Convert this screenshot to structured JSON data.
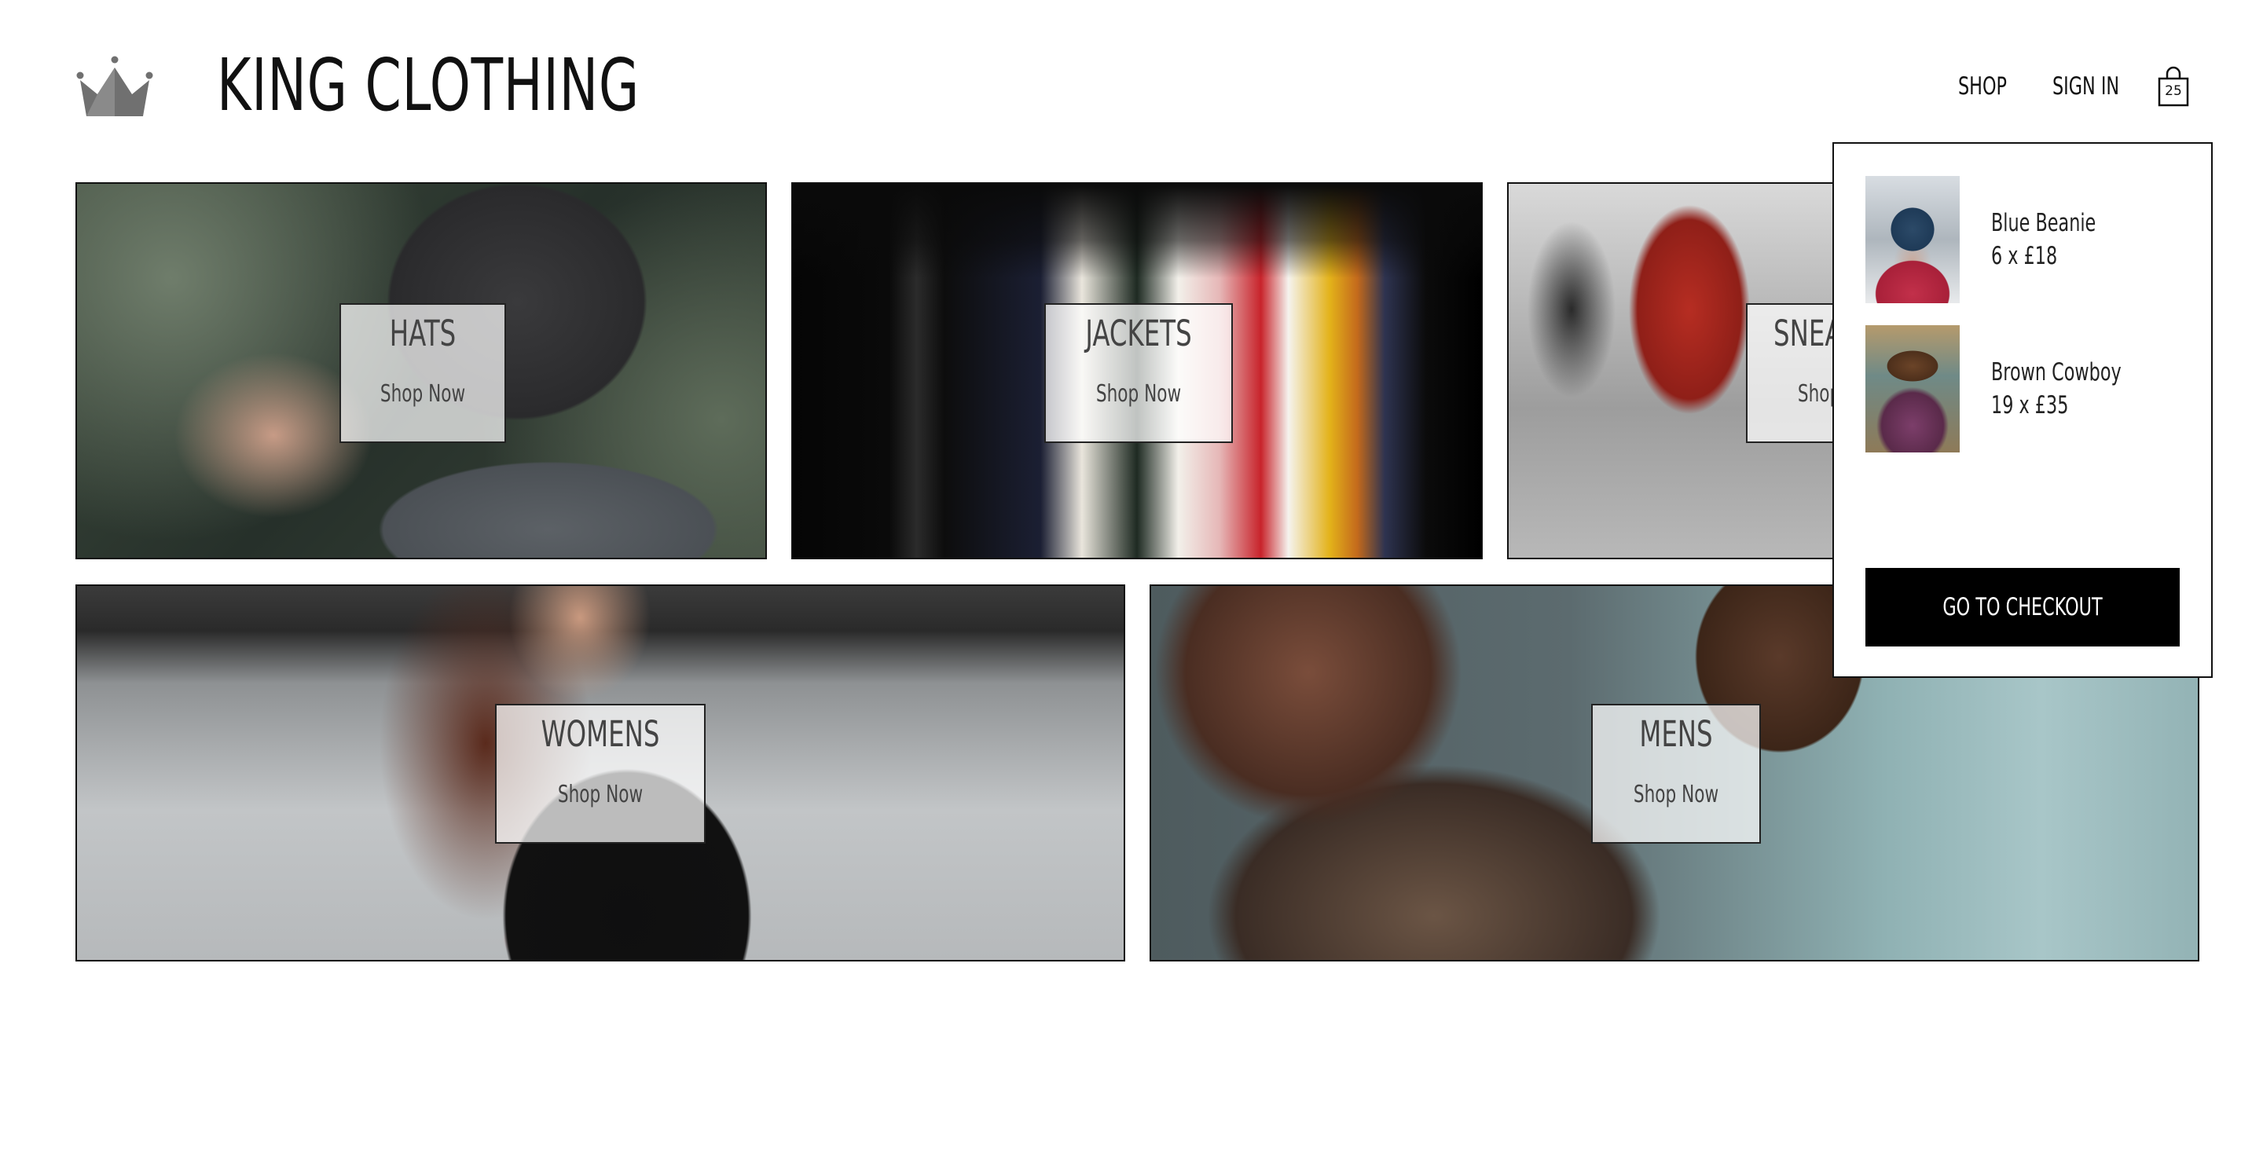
{
  "header": {
    "brand": "KING CLOTHING",
    "logo_icon": "crown-icon",
    "nav": {
      "shop": "SHOP",
      "sign_in": "SIGN IN"
    },
    "cart": {
      "icon": "shopping-bag-icon",
      "count": "25"
    }
  },
  "categories": [
    {
      "title": "HATS",
      "action": "Shop Now"
    },
    {
      "title": "JACKETS",
      "action": "Shop Now"
    },
    {
      "title": "SNEAKERS",
      "action": "Shop Now"
    },
    {
      "title": "WOMENS",
      "action": "Shop Now"
    },
    {
      "title": "MENS",
      "action": "Shop Now"
    }
  ],
  "cart_dropdown": {
    "items": [
      {
        "name": "Blue Beanie",
        "quantity_price": "6 x £18"
      },
      {
        "name": "Brown Cowboy",
        "quantity_price": "19 x £35"
      }
    ],
    "checkout_label": "GO TO CHECKOUT"
  },
  "colors": {
    "text": "#111111",
    "button": "#000000",
    "button_text": "#ffffff",
    "label_bg": "rgba(255,255,255,0.72)",
    "logo": "#7a7a7a"
  }
}
